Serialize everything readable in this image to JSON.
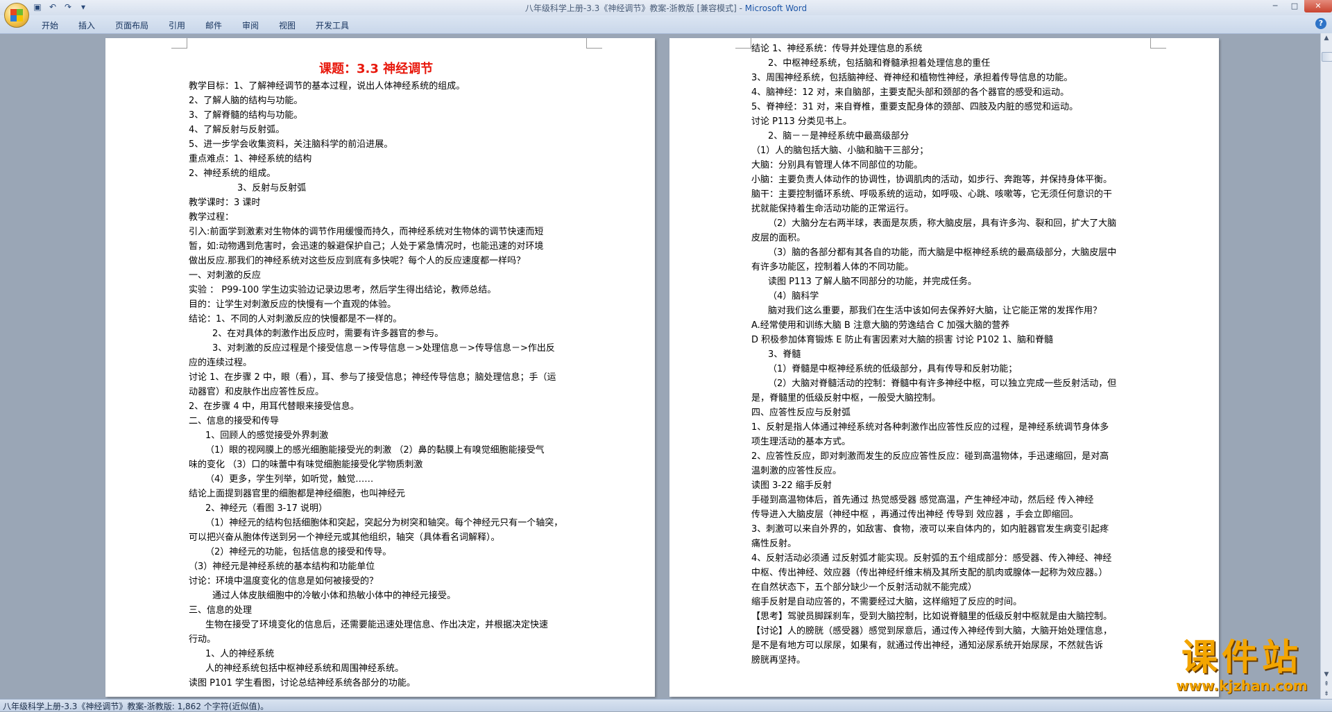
{
  "window": {
    "title": "八年级科学上册-3.3《神经调节》教案-浙教版 [兼容模式] - ",
    "app_name": "Microsoft Word",
    "controls": [
      "─",
      "□",
      "✕"
    ]
  },
  "ribbon_tabs": [
    "开始",
    "插入",
    "页面布局",
    "引用",
    "邮件",
    "审阅",
    "视图",
    "开发工具"
  ],
  "help_label": "?",
  "left_page": {
    "title": "课题：3.3 神经调节",
    "lines": [
      "教学目标：1、了解神经调节的基本过程，说出人体神经系统的组成。",
      "2、了解人脑的结构与功能。",
      "3、了解脊髓的结构与功能。",
      "4、了解反射与反射弧。",
      "5、进一步学会收集资料，关注脑科学的前沿进展。",
      "重点难点：1、神经系统的结构",
      "2、神经系统的组成。",
      "3、反射与反射弧",
      "教学课时：3 课时",
      "教学过程：",
      "引入:前面学到激素对生物体的调节作用缓慢而持久，而神经系统对生物体的调节快速而短",
      "暂，如:动物遇到危害时，会迅速的躲避保护自己；人处于紧急情况时，也能迅速的对环境",
      "做出反应.那我们的神经系统对这些反应到底有多快呢？每个人的反应速度都一样吗？",
      "一、对刺激的反应",
      "实验 ： P99-100 学生边实验边记录边思考，然后学生得出结论，教师总结。",
      "目的：让学生对刺激反应的快慢有一个直观的体验。",
      "结论：1、不同的人对刺激反应的快慢都是不一样的。",
      "2、在对具体的刺激作出反应时，需要有许多器官的参与。",
      "3、对刺激的反应过程是个接受信息－>传导信息－>处理信息－>传导信息－>作出反",
      "应的连续过程。",
      "讨论 1、在步骤 2 中，眼（看），耳、参与了接受信息；神经传导信息；脑处理信息；手（运",
      "动器官）和皮肤作出应答性反应。",
      "2、在步骤 4 中，用耳代替眼来接受信息。",
      "二、信息的接受和传导",
      "1、回顾人的感觉接受外界刺激",
      "（1）眼的视网膜上的感光细胞能接受光的刺激    （2）鼻的黏膜上有嗅觉细胞能接受气",
      "味的变化    （3）口的味蕾中有味觉细胞能接受化学物质刺激",
      "（4）更多，学生列举，如听觉，触觉……",
      "结论上面提到器官里的细胞都是神经细胞，也叫神经元",
      "2、神经元（看图 3-17 说明）",
      "（1）神经元的结构包括细胞体和突起，突起分为树突和轴突。每个神经元只有一个轴突，",
      "可以把兴奋从胞体传送到另一个神经元或其他组织，轴突（具体看名词解释）。",
      "（2）神经元的功能，包括信息的接受和传导。",
      "（3）神经元是神经系统的基本结构和功能单位",
      "讨论：环境中温度变化的信息是如何被接受的？",
      "通过人体皮肤细胞中的冷敏小体和热敏小体中的神经元接受。",
      "三、信息的处理",
      "生物在接受了环境变化的信息后，还需要能迅速处理信息、作出决定，并根据决定快速",
      "行动。",
      "1、人的神经系统",
      "人的神经系统包括中枢神经系统和周围神经系统。",
      "读图  P101 学生看图，讨论总结神经系统各部分的功能。"
    ]
  },
  "right_page": {
    "lines": [
      "结论 1、神经系统：传导并处理信息的系统",
      "2、中枢神经系统，包括脑和脊髓承担着处理信息的重任",
      "3、周围神经系统，包括脑神经、脊神经和植物性神经，承担着传导信息的功能。",
      "4、脑神经：12 对，来自脑部，主要支配头部和颈部的各个器官的感受和运动。",
      "5、脊神经：31 对，来自脊椎，重要支配身体的颈部、四肢及内脏的感觉和运动。",
      "讨论 P113 分类见书上。",
      "2、脑－－是神经系统中最高级部分",
      "（1）人的脑包括大脑、小脑和脑干三部分；",
      "大脑：分别具有管理人体不同部位的功能。",
      "小脑：主要负责人体动作的协调性，协调肌肉的活动，如步行、奔跑等，并保持身体平衡。",
      "脑干：主要控制循环系统、呼吸系统的运动，如呼吸、心跳、咳嗽等，它无须任何意识的干",
      "扰就能保持着生命活动功能的正常运行。",
      "（2）大脑分左右两半球，表面是灰质，称大脑皮层，具有许多沟、裂和回，扩大了大脑",
      "皮层的面积。",
      "（3）脑的各部分都有其各自的功能，而大脑是中枢神经系统的最高级部分，大脑皮层中",
      "有许多功能区，控制着人体的不同功能。",
      "读图 P113 了解人脑不同部分的功能，并完成任务。",
      "（4）脑科学",
      "脑对我们这么重要，那我们在生活中该如何去保养好大脑，让它能正常的发挥作用？",
      "A.经常使用和训练大脑 B 注意大脑的劳逸结合 C 加强大脑的营养",
      "D 积极参加体育锻炼 E 防止有害因素对大脑的损害 讨论 P102  1、脑和脊髓",
      "3、脊髓",
      "（1）脊髓是中枢神经系统的低级部分，具有传导和反射功能；",
      "（2）大脑对脊髓活动的控制：脊髓中有许多神经中枢，可以独立完成一些反射活动，但",
      "是，脊髓里的低级反射中枢，一般受大脑控制。",
      "四、应答性反应与反射弧",
      "1、反射是指人体通过神经系统对各种刺激作出应答性反应的过程，是神经系统调节身体多",
      "项生理活动的基本方式。",
      "2、应答性反应，即对刺激而发生的反应应答性反应：碰到高温物体，手迅速缩回，是对高",
      "温刺激的应答性反应。",
      "读图 3-22 缩手反射",
      "手碰到高温物体后，首先通过 热觉感受器  感觉高温，产生神经冲动，然后经  传入神经",
      "传导进入大脑皮层（神经中枢 ，再通过传出神经    传导到  效应器   ，手会立即缩回。",
      "3、刺激可以来自外界的，如敌害、食物，液可以来自体内的，如内脏器官发生病变引起疼",
      "痛性反射。",
      "4、反射活动必须通 过反射弧才能实现。反射弧的五个组成部分：感受器、传入神经、神经",
      "中枢、传出神经、效应器（传出神经纤维末梢及其所支配的肌肉或腺体一起称为效应器。）",
      "在自然状态下，五个部分缺少一个反射活动就不能完成）",
      "缩手反射是自动应答的，不需要经过大脑，这样缩短了反应的时间。",
      "【思考】驾驶员脚踩刹车，受到大脑控制，比如说脊髓里的低级反射中枢就是由大脑控制。",
      "【讨论】人的膀胱（感受器）感觉到尿意后，通过传入神经传到大脑，大脑开始处理信息，",
      "是不是有地方可以尿尿，如果有，就通过传出神经，通知泌尿系统开始尿尿，不然就告诉",
      "膀胱再坚持。"
    ]
  },
  "status_bar": "八年级科学上册-3.3《神经调节》教案-浙教版: 1,862 个字符(近似值)。",
  "watermark": {
    "text": "课件站",
    "url": "www.kjzhan.com"
  }
}
